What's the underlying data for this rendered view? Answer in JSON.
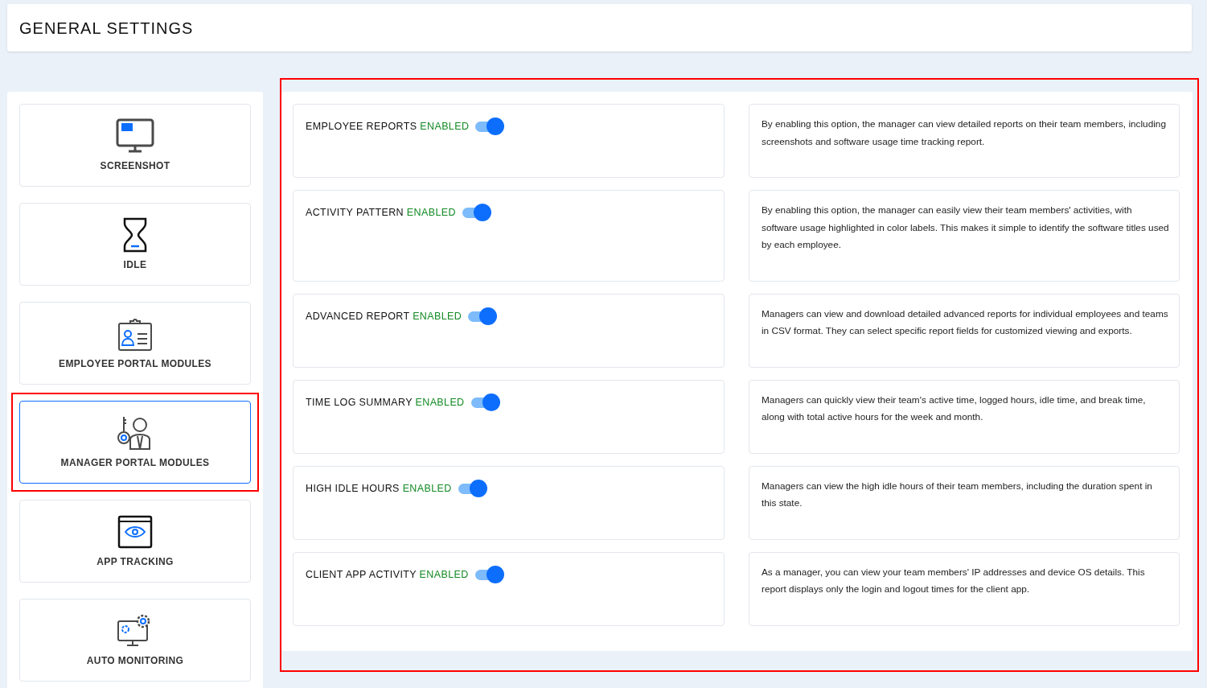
{
  "header": {
    "title": "GENERAL SETTINGS"
  },
  "modules": [
    {
      "kind": "monitor",
      "label": "SCREENSHOT",
      "selected": false,
      "highlighted": false
    },
    {
      "kind": "hourglass",
      "label": "IDLE",
      "selected": false,
      "highlighted": false
    },
    {
      "kind": "badge",
      "label": "EMPLOYEE PORTAL MODULES",
      "selected": false,
      "highlighted": false
    },
    {
      "kind": "manager",
      "label": "MANAGER PORTAL MODULES",
      "selected": true,
      "highlighted": true
    },
    {
      "kind": "eye",
      "label": "APP TRACKING",
      "selected": false,
      "highlighted": false
    },
    {
      "kind": "gears",
      "label": "AUTO MONITORING",
      "selected": false,
      "highlighted": false
    }
  ],
  "settings_panel": {
    "highlighted": true,
    "settings": [
      {
        "name": "EMPLOYEE REPORTS",
        "status": "ENABLED",
        "on": true,
        "description": "By enabling this option, the manager can view detailed reports on their team members, including screenshots and software usage time tracking report."
      },
      {
        "name": "ACTIVITY PATTERN",
        "status": "ENABLED",
        "on": true,
        "description": "By enabling this option, the manager can easily view their team members' activities, with software usage highlighted in color labels. This makes it simple to identify the software titles used by each employee."
      },
      {
        "name": "ADVANCED REPORT",
        "status": "ENABLED",
        "on": true,
        "description": "Managers can view and download detailed advanced reports for individual employees and teams in CSV format. They can select specific report fields for customized viewing and exports."
      },
      {
        "name": "TIME LOG SUMMARY",
        "status": "ENABLED",
        "on": true,
        "description": "Managers can quickly view their team's active time, logged hours, idle time, and break time, along with total active hours for the week and month."
      },
      {
        "name": "HIGH IDLE HOURS",
        "status": "ENABLED",
        "on": true,
        "description": "Managers can view the high idle hours of their team members, including the duration spent in this state."
      },
      {
        "name": "CLIENT APP ACTIVITY",
        "status": "ENABLED",
        "on": true,
        "description": "As a manager, you can view your team members' IP addresses and device OS details. This report displays only the login and logout times for the client app."
      }
    ]
  }
}
